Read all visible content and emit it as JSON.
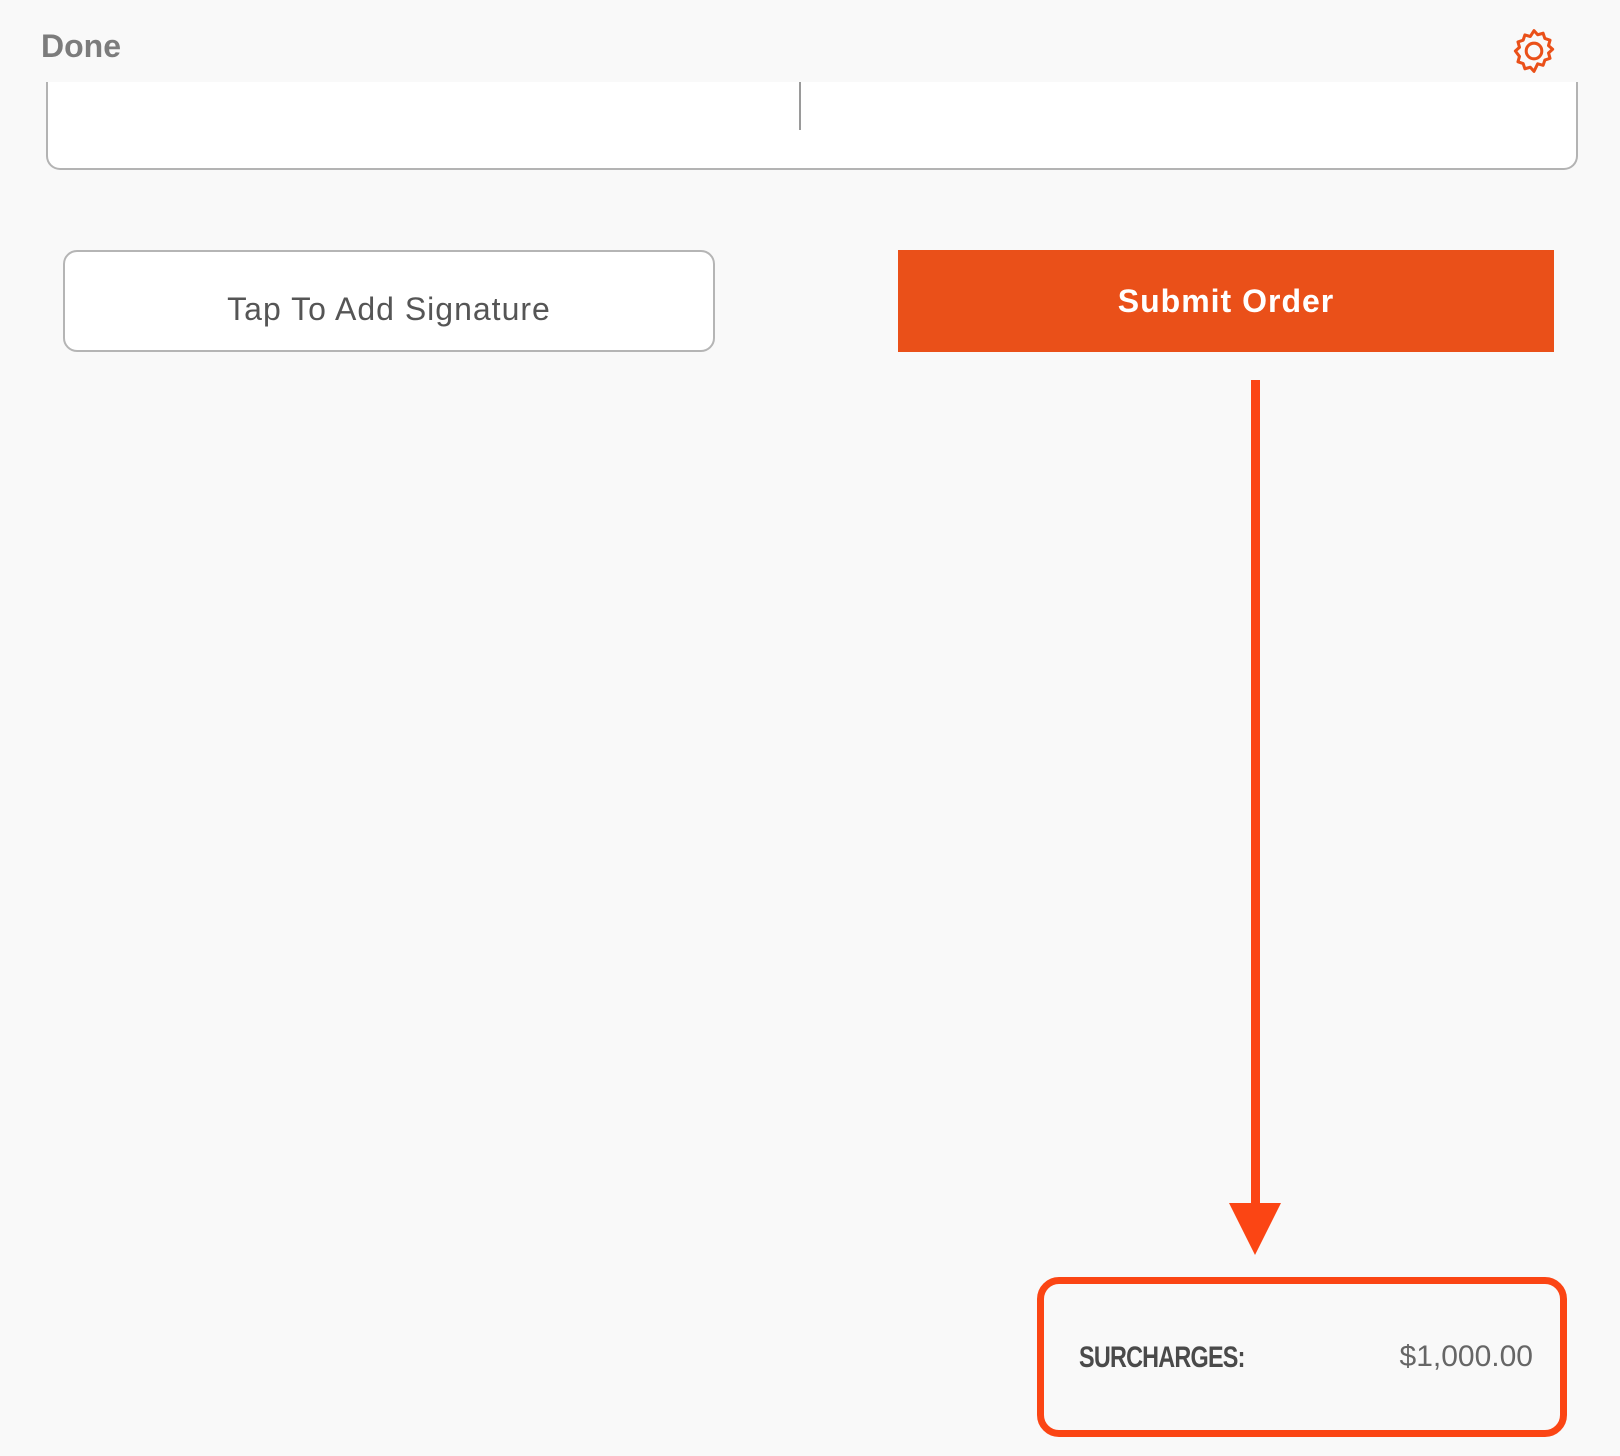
{
  "header": {
    "done_label": "Done",
    "settings_icon": "gear-icon"
  },
  "actions": {
    "signature_label": "Tap To Add Signature",
    "submit_label": "Submit Order"
  },
  "summary": {
    "surcharges_label": "SURCHARGES:",
    "surcharges_value": "$1,000.00"
  },
  "colors": {
    "accent": "#ea5019",
    "annotation": "#fb4514",
    "background": "#f9f9f9"
  }
}
